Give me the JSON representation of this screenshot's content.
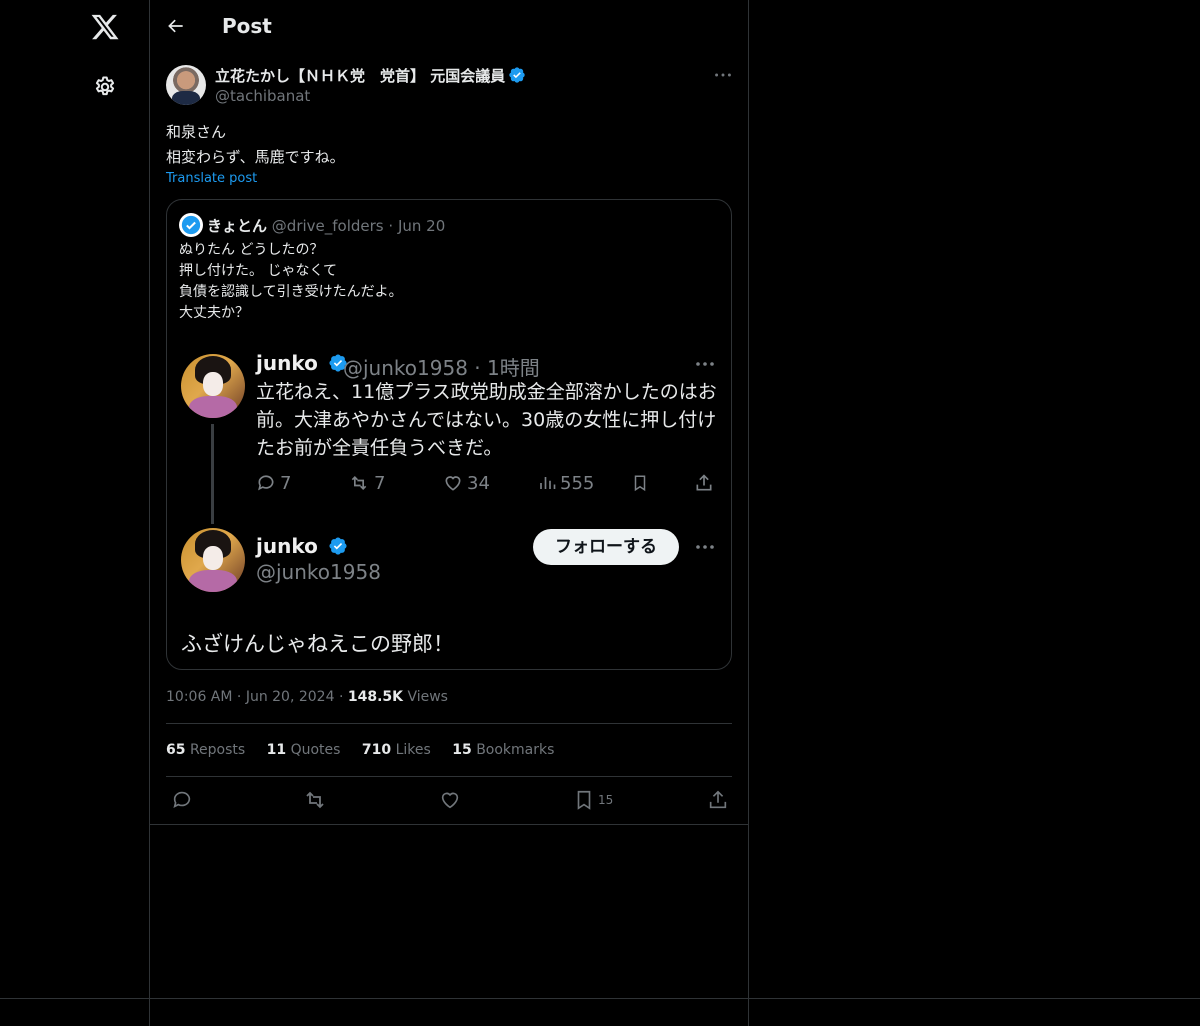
{
  "header": {
    "title": "Post"
  },
  "post": {
    "author_name": "立花たかし【ＮＨＫ党　党首】 元国会議員",
    "author_handle": "@tachibanat",
    "text": "和泉さん\n相変わらず、馬鹿ですね。",
    "translate_label": "Translate post",
    "time": "10:06 AM",
    "date": "Jun 20, 2024",
    "views_count": "148.5K",
    "views_label": "Views",
    "sep": "·"
  },
  "quote": {
    "name": "きょとん",
    "handle": "@drive_folders",
    "date": "Jun 20",
    "text": "ぬりたん どうしたの？\n押し付けた。 じゃなくて\n負債を認識して引き受けたんだよ。\n大丈夫か？",
    "screenshot": {
      "first_name": "junko",
      "first_handle_time": "@junko1958 · 1時間",
      "first_text": "立花ねえ、11億プラス政党助成金全部溶かしたのはお前。大津あやかさんではない。30歳の女性に押し付けたお前が全責任負うべきだ。",
      "replies": "7",
      "reposts": "7",
      "likes": "34",
      "views": "555",
      "second_name": "junko",
      "second_handle": "@junko1958",
      "follow_label": "フォローする",
      "reply_text": "ふざけんじゃねえこの野郎！"
    }
  },
  "stats": [
    {
      "count": "65",
      "label": "Reposts"
    },
    {
      "count": "11",
      "label": "Quotes"
    },
    {
      "count": "710",
      "label": "Likes"
    },
    {
      "count": "15",
      "label": "Bookmarks"
    }
  ],
  "actions": {
    "bookmark_count": "15"
  },
  "colors": {
    "accent": "#1d9bf0",
    "background": "#000000",
    "border": "#2f3336",
    "muted": "#71767b"
  }
}
